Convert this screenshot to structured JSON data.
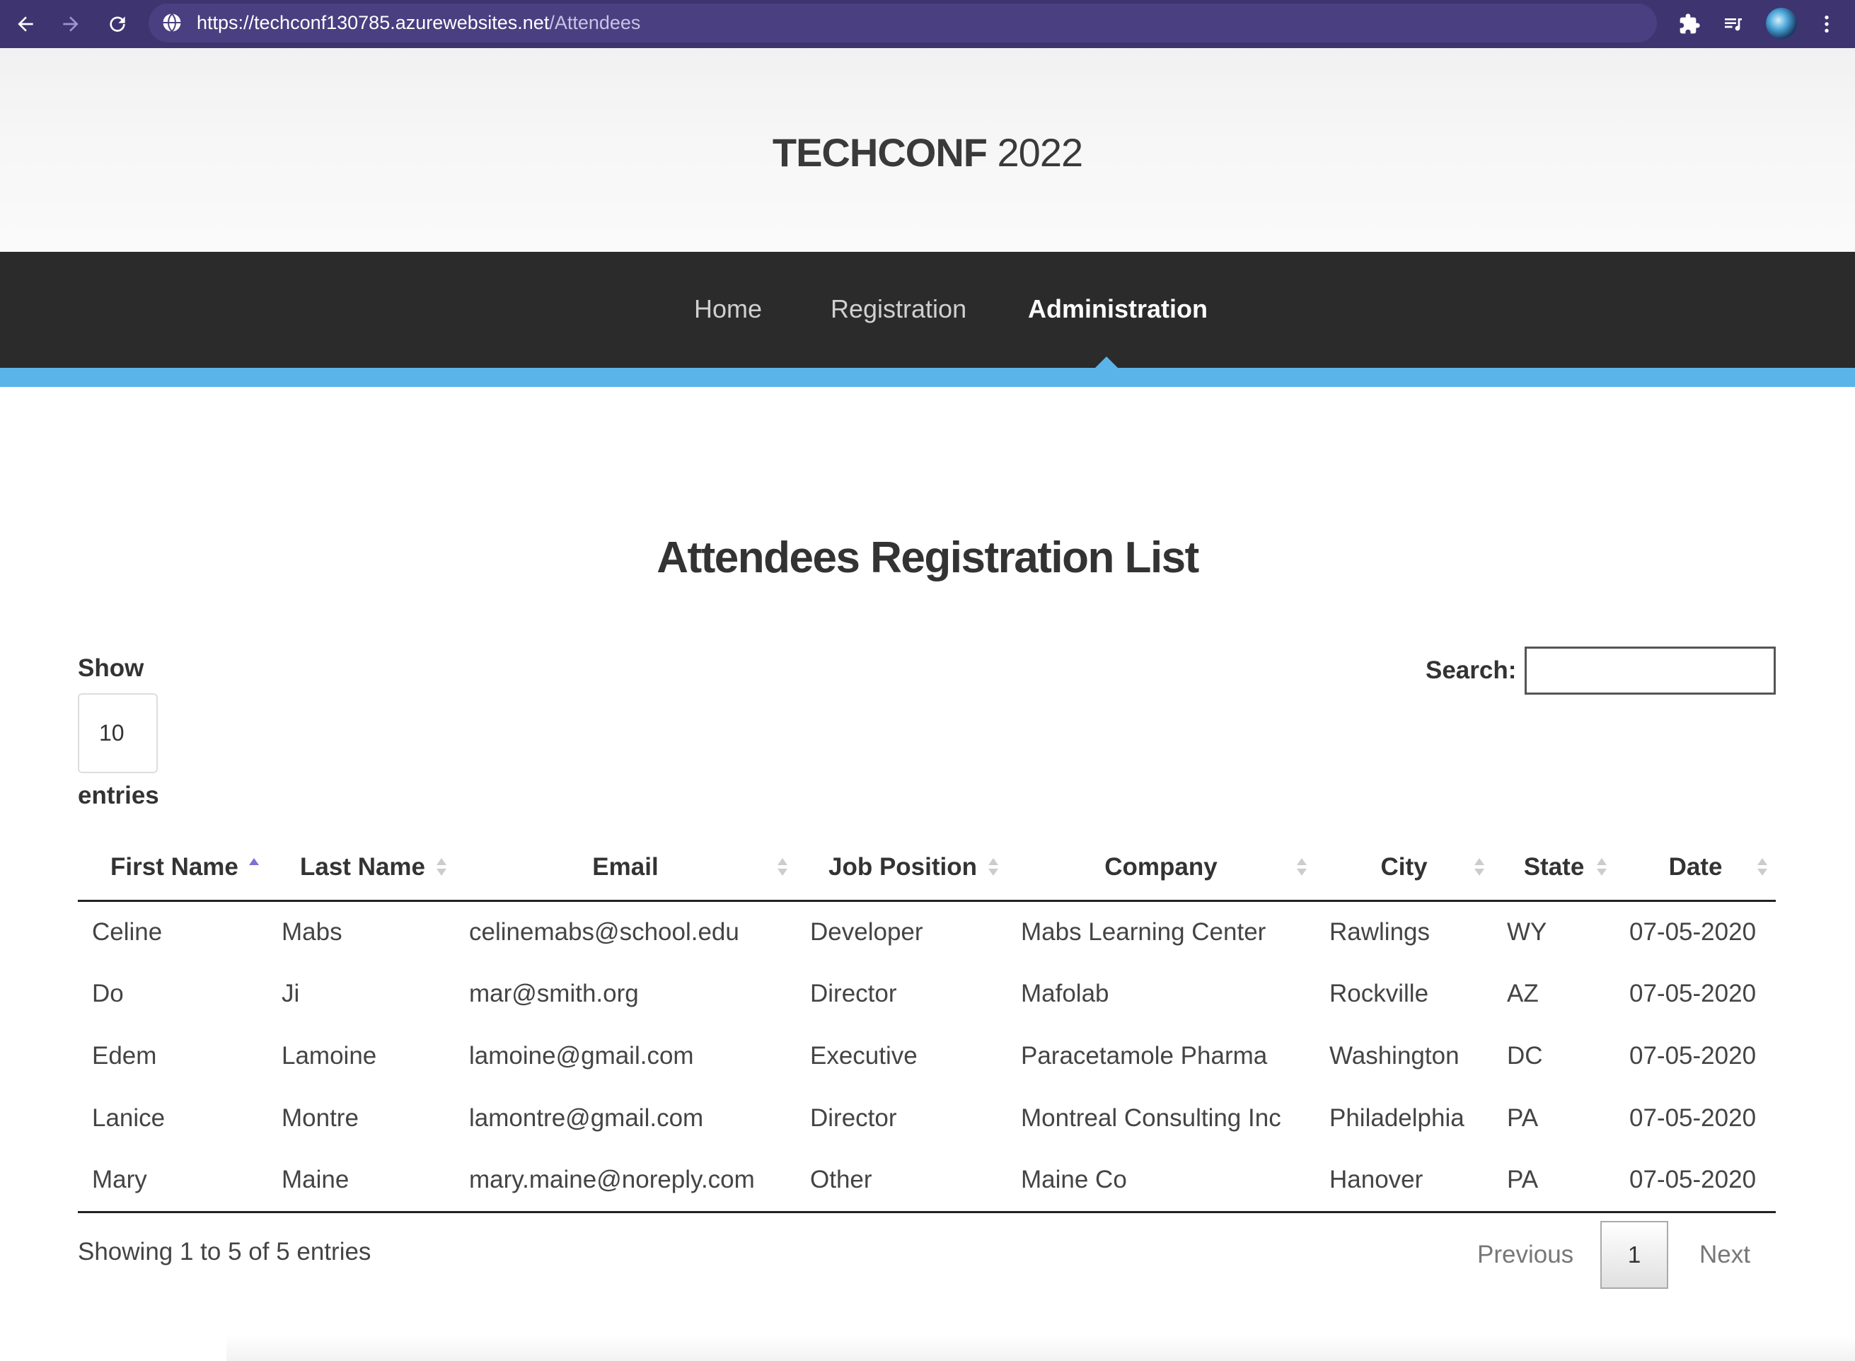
{
  "browser": {
    "url_base": "https://techconf130785.azurewebsites.net",
    "url_path": "/Attendees"
  },
  "site": {
    "brand_bold": "TECHCONF",
    "brand_year": "2022"
  },
  "nav": {
    "home": "Home",
    "registration": "Registration",
    "administration": "Administration"
  },
  "page": {
    "title": "Attendees Registration List",
    "show_label": "Show",
    "length_value": "10",
    "entries_label": "entries",
    "search_label": "Search:",
    "search_value": ""
  },
  "table": {
    "columns": [
      "First Name",
      "Last Name",
      "Email",
      "Job Position",
      "Company",
      "City",
      "State",
      "Date"
    ],
    "rows": [
      [
        "Celine",
        "Mabs",
        "celinemabs@school.edu",
        "Developer",
        "Mabs Learning Center",
        "Rawlings",
        "WY",
        "07-05-2020"
      ],
      [
        "Do",
        "Ji",
        "mar@smith.org",
        "Director",
        "Mafolab",
        "Rockville",
        "AZ",
        "07-05-2020"
      ],
      [
        "Edem",
        "Lamoine",
        "lamoine@gmail.com",
        "Executive",
        "Paracetamole Pharma",
        "Washington",
        "DC",
        "07-05-2020"
      ],
      [
        "Lanice",
        "Montre",
        "lamontre@gmail.com",
        "Director",
        "Montreal Consulting Inc",
        "Philadelphia",
        "PA",
        "07-05-2020"
      ],
      [
        "Mary",
        "Maine",
        "mary.maine@noreply.com",
        "Other",
        "Maine Co",
        "Hanover",
        "PA",
        "07-05-2020"
      ]
    ]
  },
  "footer": {
    "info": "Showing 1 to 5 of 5 entries",
    "previous": "Previous",
    "page": "1",
    "next": "Next"
  },
  "colors": {
    "browser_bar": "#3e3470",
    "nav_bg": "#2b2b2b",
    "accent": "#5ab4ea"
  }
}
